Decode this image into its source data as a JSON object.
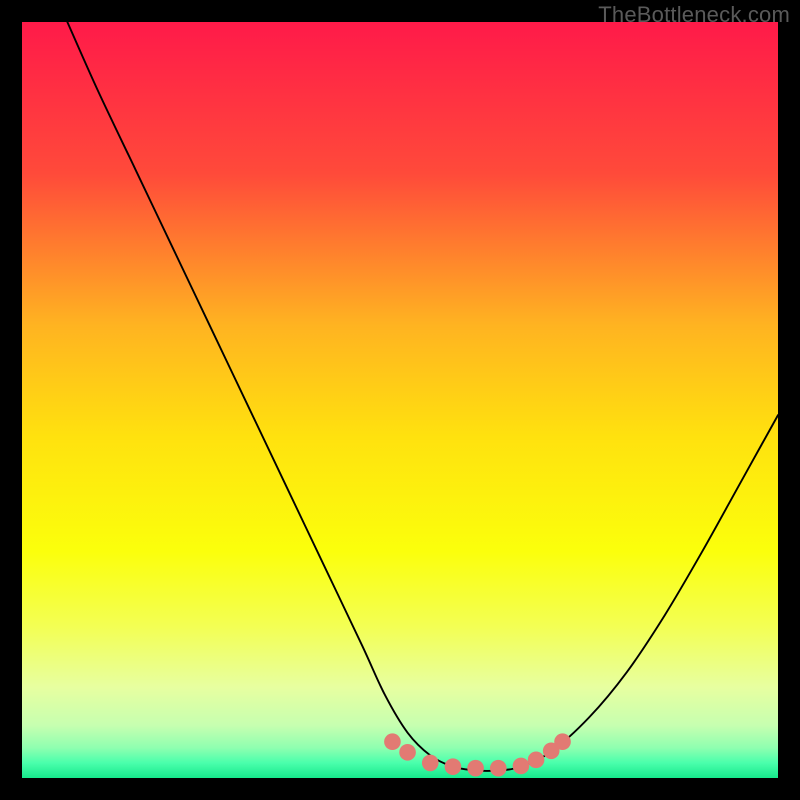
{
  "watermark": "TheBottleneck.com",
  "colors": {
    "frame": "#000000",
    "watermark": "#5a5a5a",
    "curve": "#000000",
    "marker_fill": "#e27a73",
    "marker_stroke": "#e27a73"
  },
  "chart_data": {
    "type": "line",
    "title": "",
    "xlabel": "",
    "ylabel": "",
    "xlim": [
      0,
      100
    ],
    "ylim": [
      0,
      100
    ],
    "background_gradient_stops": [
      {
        "pos": 0.0,
        "color": "#ff1a49"
      },
      {
        "pos": 0.2,
        "color": "#ff4a3a"
      },
      {
        "pos": 0.4,
        "color": "#ffb321"
      },
      {
        "pos": 0.55,
        "color": "#ffe20e"
      },
      {
        "pos": 0.7,
        "color": "#fbff0c"
      },
      {
        "pos": 0.8,
        "color": "#f3ff54"
      },
      {
        "pos": 0.88,
        "color": "#e7ffa0"
      },
      {
        "pos": 0.93,
        "color": "#c7ffb0"
      },
      {
        "pos": 0.96,
        "color": "#8fffb0"
      },
      {
        "pos": 0.98,
        "color": "#4affac"
      },
      {
        "pos": 1.0,
        "color": "#16e98c"
      }
    ],
    "series": [
      {
        "name": "bottleneck-curve",
        "x": [
          6,
          10,
          15,
          20,
          25,
          30,
          35,
          40,
          45,
          48,
          51,
          54,
          57,
          60,
          63,
          66,
          70,
          75,
          80,
          85,
          90,
          95,
          100
        ],
        "y": [
          100,
          91,
          80.5,
          70,
          59.5,
          49,
          38.5,
          28,
          17.5,
          11,
          6,
          3,
          1.5,
          1,
          1,
          1.5,
          3.5,
          8,
          14,
          21.5,
          30,
          39,
          48
        ]
      }
    ],
    "markers": {
      "name": "plateau-markers",
      "points": [
        {
          "x": 49,
          "y": 4.8
        },
        {
          "x": 51,
          "y": 3.4
        },
        {
          "x": 54,
          "y": 2.0
        },
        {
          "x": 57,
          "y": 1.5
        },
        {
          "x": 60,
          "y": 1.3
        },
        {
          "x": 63,
          "y": 1.3
        },
        {
          "x": 66,
          "y": 1.6
        },
        {
          "x": 68,
          "y": 2.4
        },
        {
          "x": 70,
          "y": 3.6
        },
        {
          "x": 71.5,
          "y": 4.8
        }
      ],
      "radius_pct": 1.1
    }
  }
}
